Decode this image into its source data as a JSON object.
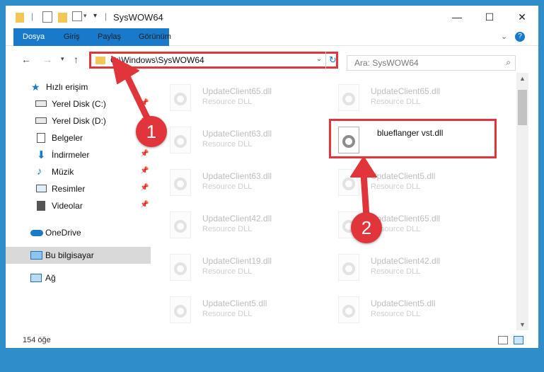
{
  "window": {
    "title": "SysWOW64"
  },
  "ribbon": {
    "tabs": [
      "Dosya",
      "Giriş",
      "Paylaş",
      "Görünüm"
    ]
  },
  "address": {
    "path": "C:\\Windows\\SysWOW64"
  },
  "search": {
    "placeholder": "Ara: SysWOW64"
  },
  "sidebar": {
    "items": [
      {
        "label": "Hızlı erişim",
        "icon": "star-icon"
      },
      {
        "label": "Yerel Disk (C:)",
        "icon": "drive-icon"
      },
      {
        "label": "Yerel Disk (D:)",
        "icon": "drive-icon"
      },
      {
        "label": "Belgeler",
        "icon": "documents-icon"
      },
      {
        "label": "İndirmeler",
        "icon": "downloads-icon"
      },
      {
        "label": "Müzik",
        "icon": "music-icon"
      },
      {
        "label": "Resimler",
        "icon": "pictures-icon"
      },
      {
        "label": "Videolar",
        "icon": "videos-icon"
      },
      {
        "label": "OneDrive",
        "icon": "cloud-icon"
      },
      {
        "label": "Bu bilgisayar",
        "icon": "computer-icon"
      },
      {
        "label": "Ağ",
        "icon": "network-icon"
      }
    ]
  },
  "files": [
    {
      "name": "UpdateClient65.dll",
      "desc": "Resource DLL"
    },
    {
      "name": "UpdateClient65.dll",
      "desc": "Resource DLL"
    },
    {
      "name": "UpdateClient63.dll",
      "desc": "Resource DLL"
    },
    {
      "name": "blueflanger vst.dll",
      "desc": ""
    },
    {
      "name": "UpdateClient63.dll",
      "desc": "Resource DLL"
    },
    {
      "name": "UpdateClient5.dll",
      "desc": "Resource DLL"
    },
    {
      "name": "UpdateClient42.dll",
      "desc": "Resource DLL"
    },
    {
      "name": "UpdateClient65.dll",
      "desc": "Resource DLL"
    },
    {
      "name": "UpdateClient19.dll",
      "desc": "Resource DLL"
    },
    {
      "name": "UpdateClient42.dll",
      "desc": "Resource DLL"
    },
    {
      "name": "UpdateClient5.dll",
      "desc": "Resource DLL"
    },
    {
      "name": "UpdateClient5.dll",
      "desc": "Resource DLL"
    }
  ],
  "status": {
    "count": "154 öğe"
  },
  "annotations": {
    "badge1": "1",
    "badge2": "2"
  },
  "colors": {
    "accent": "#1979ca",
    "annotation": "#e0353a"
  }
}
